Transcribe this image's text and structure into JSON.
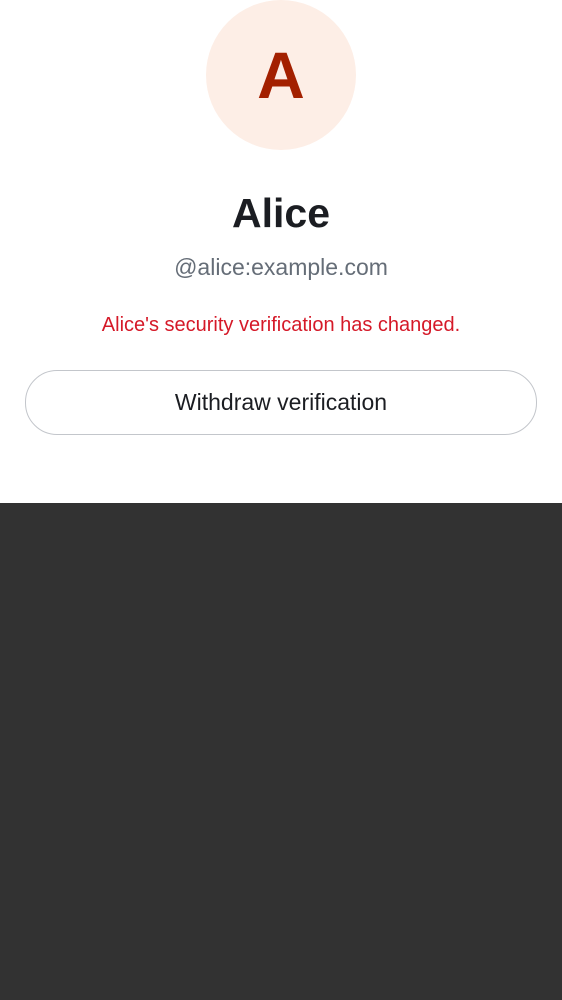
{
  "profile": {
    "avatar_initial": "A",
    "display_name": "Alice",
    "user_id": "@alice:example.com",
    "warning": "Alice's security verification has changed."
  },
  "actions": {
    "withdraw_label": "Withdraw verification"
  },
  "colors": {
    "avatar_bg": "#fdeee6",
    "avatar_text": "#a32000",
    "warning_text": "#d51928",
    "backdrop": "#323232"
  }
}
